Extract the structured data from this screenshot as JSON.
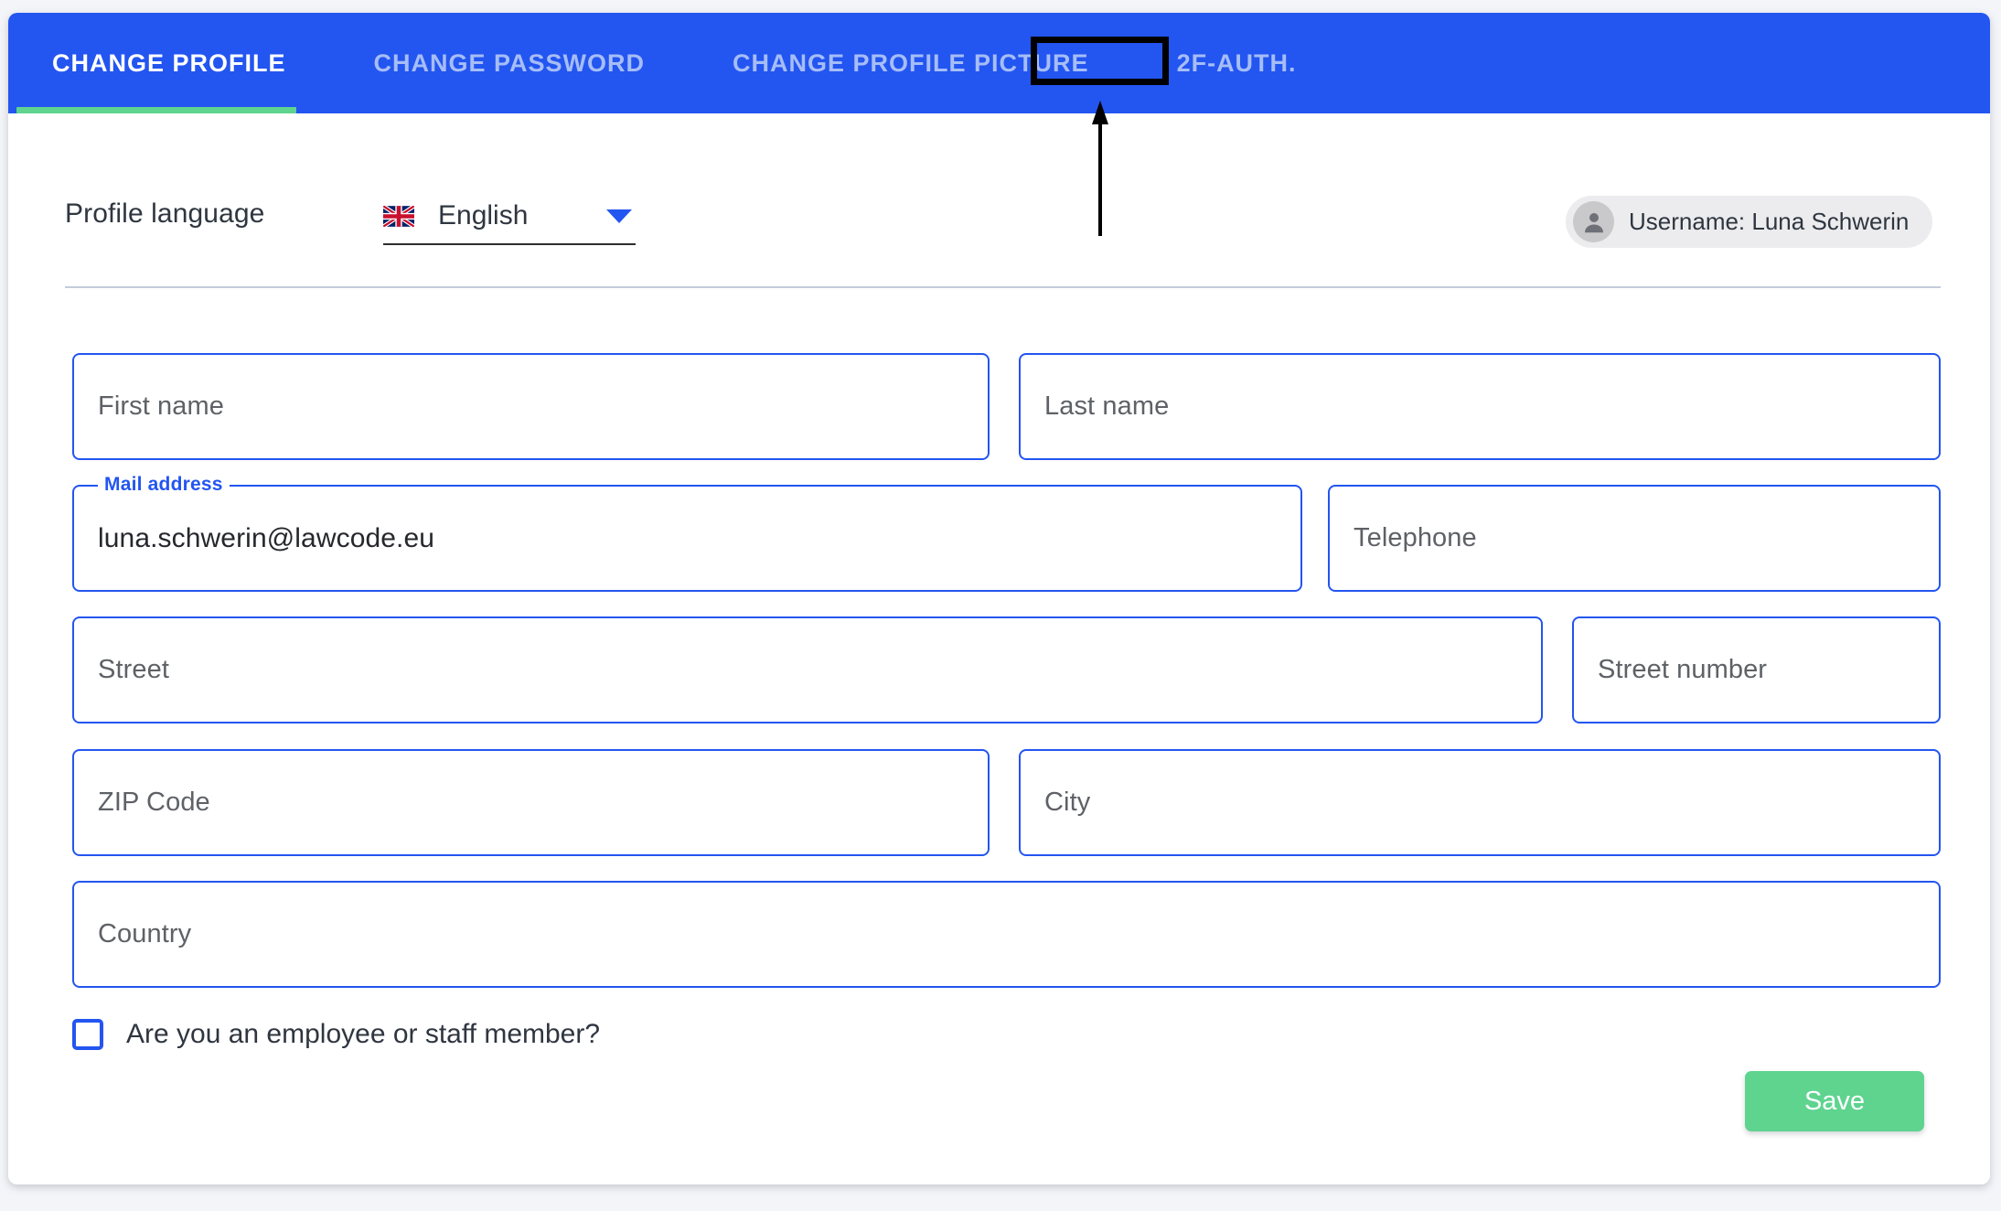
{
  "tabs": [
    {
      "label": "CHANGE PROFILE",
      "active": true
    },
    {
      "label": "CHANGE PASSWORD",
      "active": false
    },
    {
      "label": "CHANGE PROFILE PICTURE",
      "active": false
    },
    {
      "label": "2F-AUTH.",
      "active": false
    }
  ],
  "language": {
    "row_label": "Profile language",
    "selected": "English",
    "flag_icon": "uk-flag-icon",
    "caret_icon": "chevron-down-icon"
  },
  "user": {
    "badge_text": "Username: Luna Schwerin",
    "avatar_icon": "person-icon"
  },
  "form": {
    "first_name": {
      "placeholder": "First name",
      "value": ""
    },
    "last_name": {
      "placeholder": "Last name",
      "value": ""
    },
    "mail_address": {
      "label": "Mail address",
      "value": "luna.schwerin@lawcode.eu"
    },
    "telephone": {
      "placeholder": "Telephone",
      "value": ""
    },
    "street": {
      "placeholder": "Street",
      "value": ""
    },
    "street_number": {
      "placeholder": "Street number",
      "value": ""
    },
    "zip_code": {
      "placeholder": "ZIP Code",
      "value": ""
    },
    "city": {
      "placeholder": "City",
      "value": ""
    },
    "country": {
      "placeholder": "Country",
      "value": ""
    },
    "employee_checkbox": {
      "label": "Are you an employee or staff member?",
      "checked": false
    }
  },
  "actions": {
    "save_label": "Save"
  },
  "annotation": {
    "target_tab": "2F-AUTH.",
    "box_color": "#000000",
    "arrow_icon": "up-arrow-icon"
  },
  "colors": {
    "header_blue": "#2355f0",
    "accent_green": "#5ed48f",
    "field_border_blue": "#2355f0",
    "page_background": "#f4f5f9",
    "inactive_tab_text": "#a6bdf7"
  }
}
